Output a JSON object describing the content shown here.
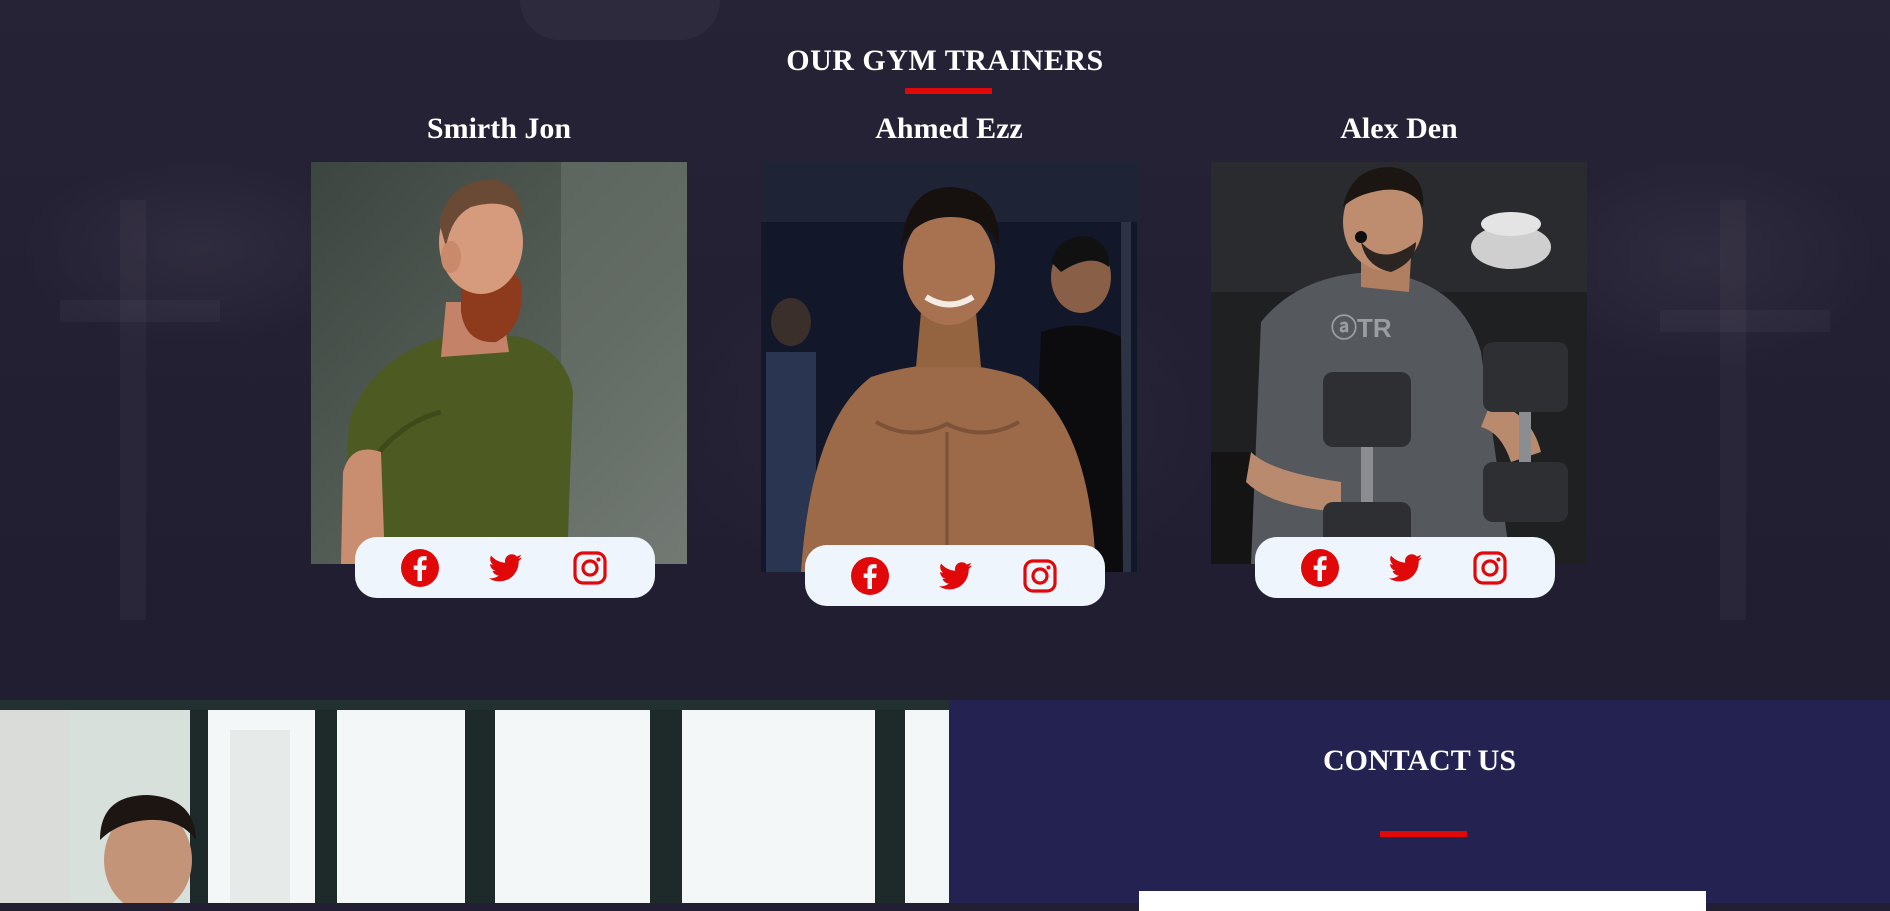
{
  "trainers_section": {
    "title": "OUR GYM TRAINERS",
    "accent_color": "#e00808",
    "trainers": [
      {
        "name": "Smirth Jon",
        "social": [
          "facebook-icon",
          "twitter-icon",
          "instagram-icon"
        ]
      },
      {
        "name": "Ahmed Ezz",
        "social": [
          "facebook-icon",
          "twitter-icon",
          "instagram-icon"
        ]
      },
      {
        "name": "Alex Den",
        "social": [
          "facebook-icon",
          "twitter-icon",
          "instagram-icon"
        ]
      }
    ]
  },
  "contact_section": {
    "title": "CONTACT US",
    "background_color": "#232250"
  }
}
